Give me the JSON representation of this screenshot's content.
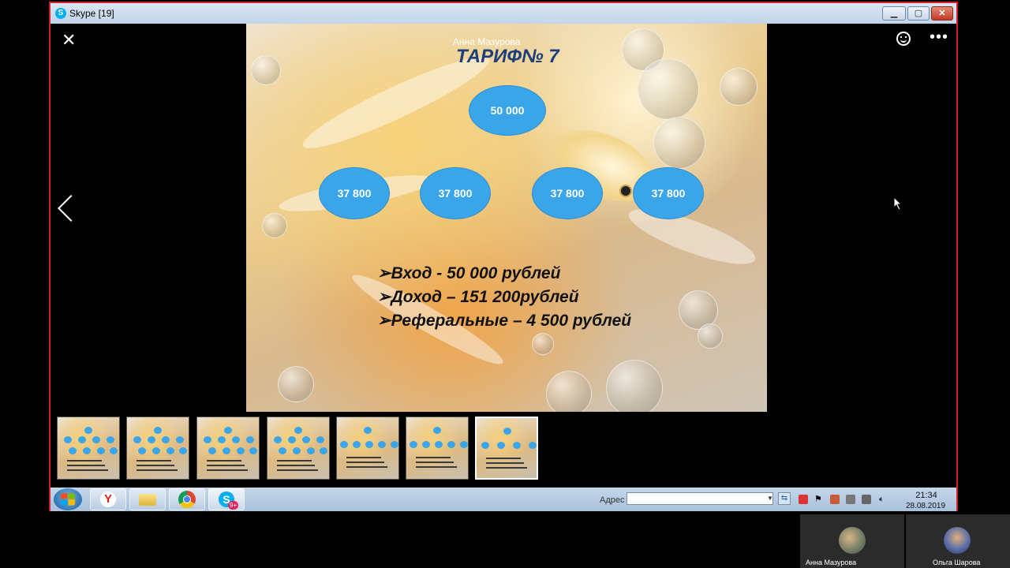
{
  "window": {
    "title": "Skype [19]",
    "icon": "skype-icon"
  },
  "viewer": {
    "close": "✕",
    "more": "•••",
    "prev": "prev-arrow-icon"
  },
  "slide": {
    "speaker": "Анна Мазурова",
    "title": "ТАРИФ№ 7",
    "top_node": "50 000",
    "nodes": [
      "37 800",
      "37 800",
      "37 800",
      "37 800"
    ],
    "lines": [
      "➢Вход  - 50 000 рублей",
      "➢Доход – 151 200рублей",
      "➢Реферальные – 4 500 рублей"
    ]
  },
  "thumbnails": {
    "count": 7,
    "selected_index": 6
  },
  "taskbar": {
    "address_label": "Адрес",
    "address_value": "",
    "skype_badge": "9+",
    "time": "21:34",
    "date": "28.08.2019"
  },
  "participants": [
    {
      "name": "Анна Мазурова"
    },
    {
      "name": "Ольга Шарова"
    }
  ]
}
